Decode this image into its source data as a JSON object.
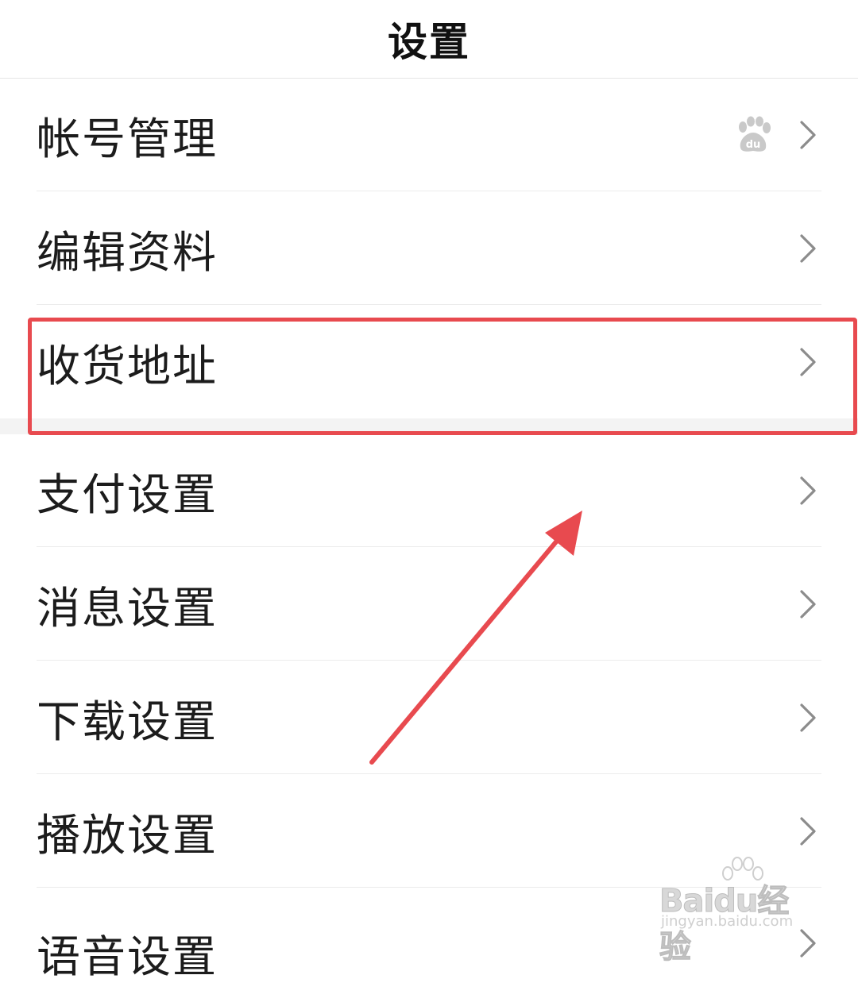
{
  "header": {
    "title": "设置"
  },
  "settings": {
    "items": [
      {
        "label": "帐号管理",
        "icon": "baidu-paw-icon"
      },
      {
        "label": "编辑资料"
      },
      {
        "label": "收货地址"
      },
      {
        "label": "支付设置"
      },
      {
        "label": "消息设置"
      },
      {
        "label": "下载设置"
      },
      {
        "label": "播放设置"
      },
      {
        "label": "语音设置"
      }
    ]
  },
  "annotation": {
    "highlight_color": "#e84a4f"
  },
  "watermark": {
    "brand": "Bai",
    "brand_du": "du",
    "brand_suffix": "经验",
    "url": "jingyan.baidu.com"
  }
}
